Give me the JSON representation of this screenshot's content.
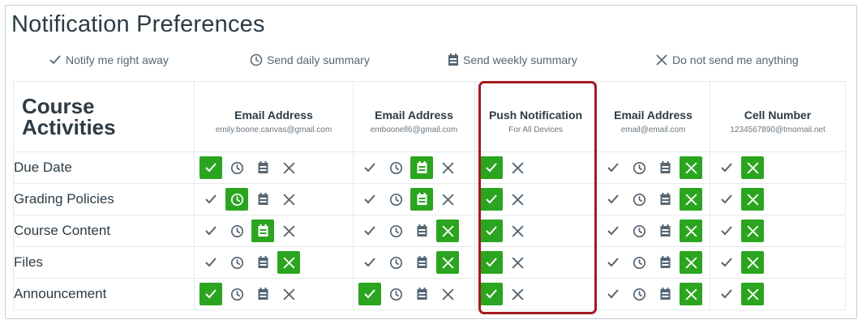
{
  "title": "Notification Preferences",
  "legend": [
    {
      "icon": "check-icon",
      "label": "Notify me right away"
    },
    {
      "icon": "clock-icon",
      "label": "Send daily summary"
    },
    {
      "icon": "calendar-icon",
      "label": "Send weekly summary"
    },
    {
      "icon": "x-icon",
      "label": "Do not send me anything"
    }
  ],
  "table": {
    "activities_title_line1": "Course",
    "activities_title_line2": "Activities",
    "channels": [
      {
        "label": "Email Address",
        "sub": "emily.boone.canvas@gmail.com",
        "options": [
          "check",
          "clock",
          "calendar",
          "x"
        ]
      },
      {
        "label": "Email Address",
        "sub": "emboonell6@gmail.com",
        "options": [
          "check",
          "clock",
          "calendar",
          "x"
        ]
      },
      {
        "label": "Push Notification",
        "sub": "For All Devices",
        "options": [
          "check",
          "x"
        ]
      },
      {
        "label": "Email Address",
        "sub": "email@email.com",
        "options": [
          "check",
          "clock",
          "calendar",
          "x"
        ]
      },
      {
        "label": "Cell Number",
        "sub": "1234567890@tmomail.net",
        "options": [
          "check",
          "x"
        ]
      }
    ],
    "rows": [
      {
        "label": "Due Date",
        "selected": [
          "check",
          "calendar",
          "check",
          "x",
          "x"
        ]
      },
      {
        "label": "Grading Policies",
        "selected": [
          "clock",
          "calendar",
          "check",
          "x",
          "x"
        ]
      },
      {
        "label": "Course Content",
        "selected": [
          "calendar",
          "x",
          "check",
          "x",
          "x"
        ]
      },
      {
        "label": "Files",
        "selected": [
          "x",
          "x",
          "check",
          "x",
          "x"
        ]
      },
      {
        "label": "Announcement",
        "selected": [
          "check",
          "check",
          "check",
          "x",
          "x"
        ]
      }
    ]
  },
  "colors": {
    "selected_bg": "#2ba51f",
    "highlight_border": "#a31a20",
    "icon_gray": "#556572"
  }
}
